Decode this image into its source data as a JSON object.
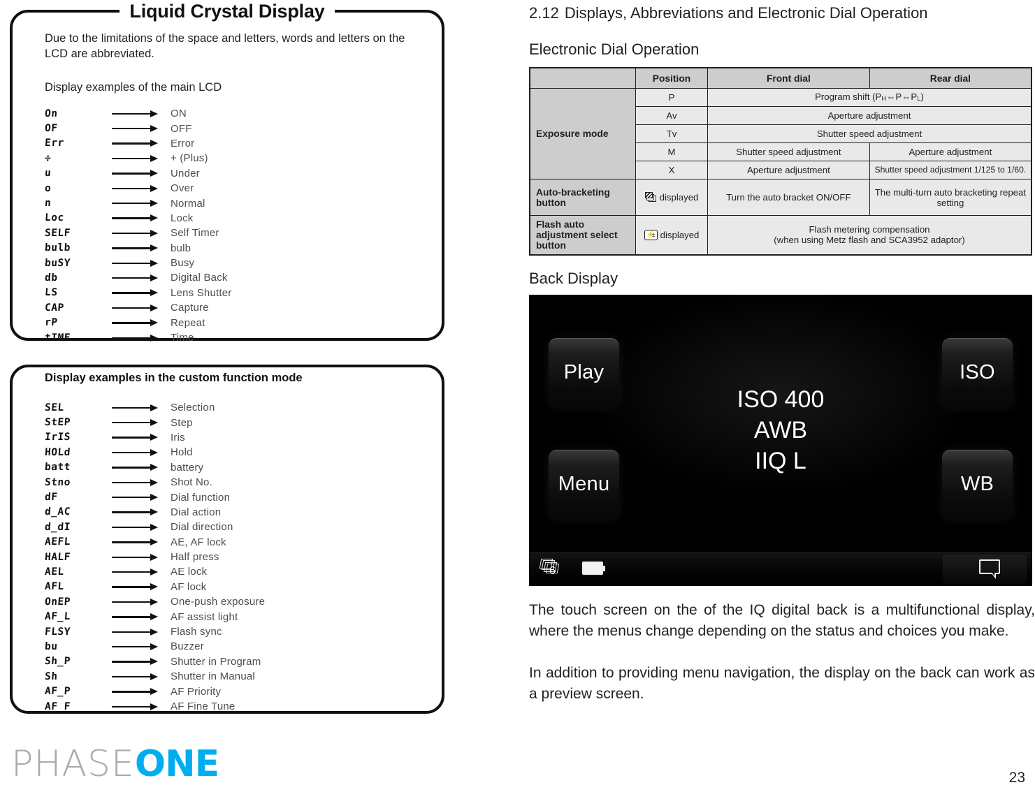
{
  "left": {
    "lcd_panel": {
      "title": "Liquid Crystal Display",
      "intro": "Due to the limitations of the space and letters, words and letters on the LCD are abbreviated.",
      "subhead": "Display examples of the main LCD",
      "rows": [
        {
          "code": "On",
          "label": "ON"
        },
        {
          "code": "OF",
          "label": "OFF"
        },
        {
          "code": "Err",
          "label": "Error"
        },
        {
          "code": "÷",
          "label": "+ (Plus)"
        },
        {
          "code": "u",
          "label": "Under"
        },
        {
          "code": "o",
          "label": "Over"
        },
        {
          "code": "n",
          "label": "Normal"
        },
        {
          "code": "Loc",
          "label": "Lock"
        },
        {
          "code": "SELF",
          "label": "Self Timer"
        },
        {
          "code": "bulb",
          "label": "bulb"
        },
        {
          "code": "buSY",
          "label": "Busy"
        },
        {
          "code": "db",
          "label": "Digital Back"
        },
        {
          "code": "LS",
          "label": "Lens Shutter"
        },
        {
          "code": "CAP",
          "label": "Capture"
        },
        {
          "code": "rP",
          "label": "Repeat"
        },
        {
          "code": "tIME",
          "label": "Time"
        }
      ]
    },
    "custom_panel": {
      "title": "Display examples in the custom function mode",
      "rows": [
        {
          "code": "SEL",
          "label": "Selection"
        },
        {
          "code": "StEP",
          "label": "Step"
        },
        {
          "code": "IrIS",
          "label": "Iris"
        },
        {
          "code": "HOLd",
          "label": "Hold"
        },
        {
          "code": "batt",
          "label": "battery"
        },
        {
          "code": "Stno",
          "label": "Shot No."
        },
        {
          "code": "dF",
          "label": "Dial function"
        },
        {
          "code": "d_AC",
          "label": "Dial action"
        },
        {
          "code": "d_dI",
          "label": "Dial direction"
        },
        {
          "code": "AEFL",
          "label": "AE, AF lock"
        },
        {
          "code": "HALF",
          "label": "Half press"
        },
        {
          "code": "AEL",
          "label": "AE lock"
        },
        {
          "code": "AFL",
          "label": "AF lock"
        },
        {
          "code": "OnEP",
          "label": "One-push exposure"
        },
        {
          "code": "AF_L",
          "label": "AF assist light"
        },
        {
          "code": "FLSY",
          "label": "Flash sync"
        },
        {
          "code": "bu",
          "label": "Buzzer"
        },
        {
          "code": "Sh_P",
          "label": "Shutter in Program"
        },
        {
          "code": "Sh",
          "label": "Shutter in Manual"
        },
        {
          "code": "AF_P",
          "label": "AF Priority"
        },
        {
          "code": "AF_F",
          "label": "AF Fine Tune"
        }
      ]
    }
  },
  "right": {
    "section_number": "2.12",
    "section_title": "Displays, Abbreviations and Electronic Dial Operation",
    "dial_heading": "Electronic Dial Operation",
    "table": {
      "headers": [
        "",
        "Position",
        "Front dial",
        "Rear dial"
      ],
      "group_exposure": "Exposure mode",
      "rows": [
        {
          "position": "P",
          "span": true,
          "front": "Program shift (PʟH⇔P⇔Pʟ)",
          "rear": ""
        },
        {
          "position": "Av",
          "span": true,
          "front": "Aperture adjustment",
          "rear": ""
        },
        {
          "position": "Tv",
          "span": true,
          "front": "Shutter speed adjustment",
          "rear": ""
        },
        {
          "position": "M",
          "span": false,
          "front": "Shutter speed adjustment",
          "rear": "Aperture adjustment"
        },
        {
          "position": "X",
          "span": false,
          "front": "Aperture adjustment",
          "rear": "Shutter speed adjustment 1/125 to 1/60."
        }
      ],
      "bracket_row": {
        "label": "Auto-bracketing button",
        "position_suffix": "displayed",
        "front": "Turn the auto bracket ON/OFF",
        "rear": "The multi-turn auto bracketing repeat setting"
      },
      "flash_row": {
        "label": "Flash auto adjustment select button",
        "position_suffix": "displayed",
        "text_line1": "Flash metering compensation",
        "text_line2": "(when using Metz flash and SCA3952 adaptor)"
      }
    },
    "back_display_heading": "Back Display",
    "back_display": {
      "buttons": {
        "play": "Play",
        "iso": "ISO",
        "menu": "Menu",
        "wb": "WB"
      },
      "center": {
        "iso": "ISO 400",
        "wb": "AWB",
        "format": "IIQ L"
      },
      "status": {
        "stack_count": "6"
      }
    },
    "paragraph_1": "The touch screen on the of the IQ digital back is a multifunctional display, where the menus change depending on the status and choices you make.",
    "paragraph_2": "In addition to providing menu navigation, the display on the back can work as a preview screen."
  },
  "footer": {
    "logo_part1": "PHASE",
    "logo_part2": "ONE",
    "page_number": "23"
  },
  "colors": {
    "brand_cyan": "#00aeef",
    "brand_gray": "#a7a9ac",
    "table_header_bg": "#cdcdcd",
    "table_cell_bg": "#e9e9e9",
    "ink": "#231f20"
  }
}
